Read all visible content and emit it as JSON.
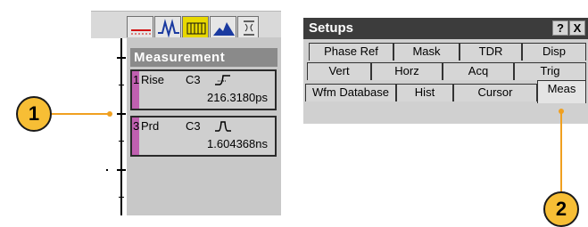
{
  "measurement": {
    "header": "Measurement",
    "entries": [
      {
        "number": "1",
        "name": "Rise",
        "source": "C3",
        "value": "216.3180ps"
      },
      {
        "number": "3",
        "name": "Prd",
        "source": "C3",
        "value": "1.604368ns"
      }
    ]
  },
  "toolbar": {
    "icons": [
      "hline-icon",
      "waveform-icon",
      "histogram-icon",
      "mountain-icon",
      "cursor-icon"
    ]
  },
  "setups": {
    "title": "Setups",
    "help_label": "?",
    "close_label": "X",
    "tabs_row1": [
      "Phase Ref",
      "Mask",
      "TDR",
      "Disp"
    ],
    "tabs_row2": [
      "Vert",
      "Horz",
      "Acq",
      "Trig"
    ],
    "tabs_row3": [
      "Wfm Database",
      "Hist",
      "Cursor",
      "Meas"
    ],
    "active_tab": "Meas"
  },
  "callouts": {
    "one": "1",
    "two": "2"
  },
  "colors": {
    "callout": "#f7be35",
    "measure_bar": "#c060b0",
    "title_bar": "#3c3c3c"
  }
}
